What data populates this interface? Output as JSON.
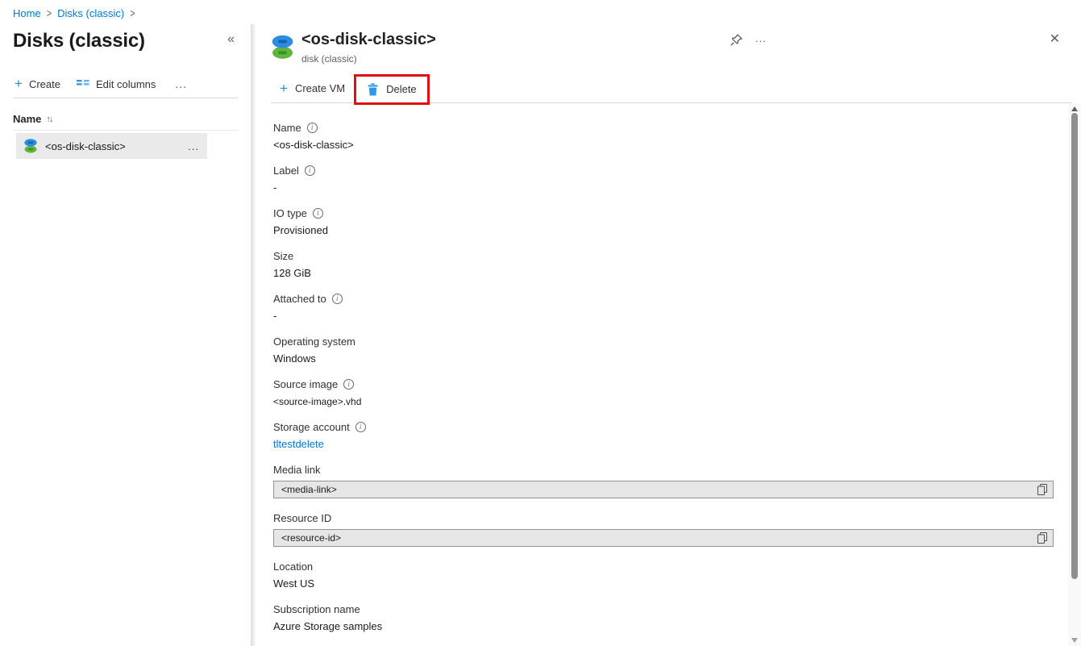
{
  "colors": {
    "accent_blue": "#0078d4",
    "annotation_red": "#e01010",
    "link_blue": "#0078d4",
    "selected_row_bg": "#eaeaea",
    "copybox_bg": "#e6e6e6"
  },
  "icons": {
    "info": "i",
    "plus": "+",
    "ellipsis": "...",
    "collapse": "«",
    "close": "✕",
    "sort": "↑↓"
  },
  "breadcrumb": {
    "separator": ">",
    "items": [
      {
        "label": "Home"
      },
      {
        "label": "Disks (classic)"
      }
    ]
  },
  "left_panel": {
    "title": "Disks (classic)",
    "toolbar": {
      "create_label": "Create",
      "edit_columns_label": "Edit columns"
    },
    "list": {
      "name_header": "Name",
      "rows": [
        {
          "name": "<os-disk-classic>"
        }
      ]
    }
  },
  "detail_panel": {
    "title": "<os-disk-classic>",
    "subtitle": "disk (classic)",
    "commands": {
      "create_vm_label": "Create VM",
      "delete_label": "Delete"
    },
    "fields": [
      {
        "label": "Name",
        "value": "<os-disk-classic>",
        "has_info": true
      },
      {
        "label": "Label",
        "value": "-",
        "has_info": true
      },
      {
        "label": "IO type",
        "value": "Provisioned",
        "has_info": true
      },
      {
        "label": "Size",
        "value": "128 GiB",
        "has_info": false
      },
      {
        "label": "Attached to",
        "value": "-",
        "has_info": true
      },
      {
        "label": "Operating system",
        "value": "Windows",
        "has_info": false
      },
      {
        "label": "Source image",
        "value": "<source-image>.vhd",
        "has_info": true
      },
      {
        "label": "Storage account",
        "value": "tltestdelete",
        "has_info": true,
        "is_link": true
      },
      {
        "label": "Media link",
        "value": "<media-link>",
        "has_info": false,
        "is_copybox": true
      },
      {
        "label": "Resource ID",
        "value": "<resource-id>",
        "has_info": false,
        "is_copybox": true
      },
      {
        "label": "Location",
        "value": "West US",
        "has_info": false
      },
      {
        "label": "Subscription name",
        "value": "Azure Storage samples",
        "has_info": false
      }
    ]
  }
}
